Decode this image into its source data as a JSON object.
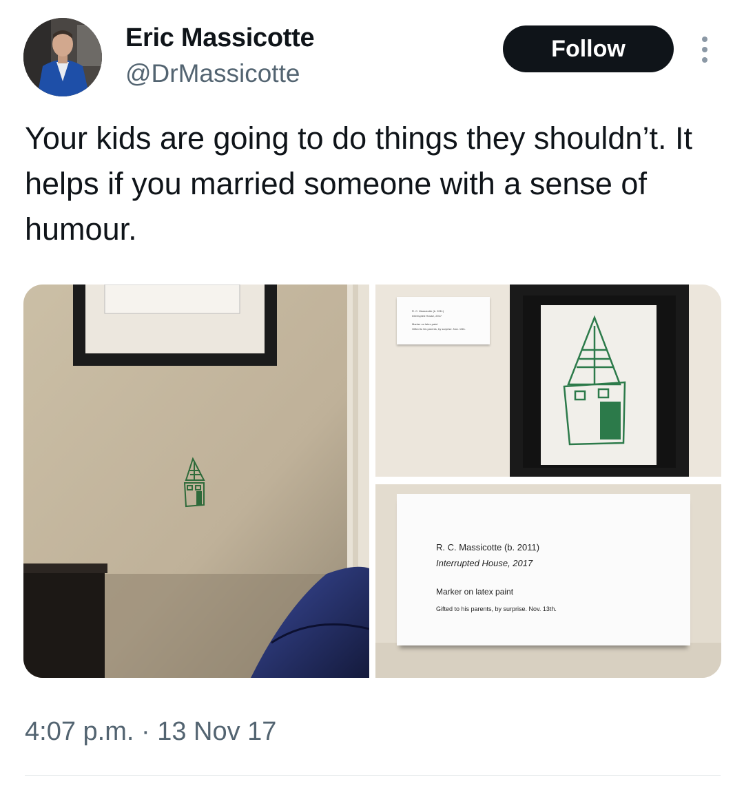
{
  "author": {
    "name": "Eric Massicotte",
    "handle": "@DrMassicotte"
  },
  "follow_label": "Follow",
  "tweet": {
    "text": "Your kids are going to do things they shouldn’t. It helps if you married someone with a sense of humour.",
    "timestamp": "4:07 p.m. · 13 Nov 17"
  },
  "placard": {
    "artist": "R. C. Massicotte (b. 2011)",
    "title": "Interrupted House, 2017",
    "medium": "Marker on latex paint",
    "credit": "Gifted to his parents, by surprise. Nov. 13th."
  },
  "icons": {
    "more": "more-options-icon"
  }
}
